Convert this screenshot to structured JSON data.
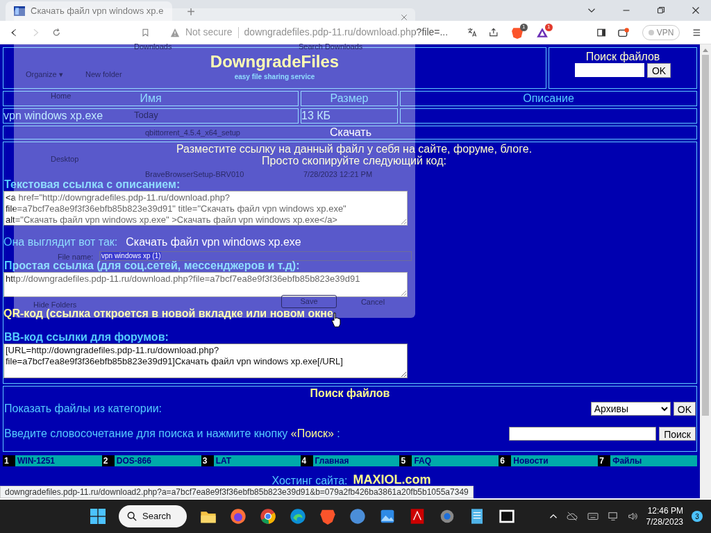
{
  "browser": {
    "tab_title": "Скачать файл vpn windows xp.e",
    "new_tab": "+",
    "security": "Not secure",
    "url": "downgradefiles.pdp-11.ru/download.php?file=...",
    "shields_badge": "1",
    "rewards_badge": "1",
    "vpn": "VPN"
  },
  "site": {
    "logo": "DowngradeFiles",
    "tagline": "easy file sharing service",
    "search_title": "Поиск файлов",
    "search_button": "OK"
  },
  "file_table": {
    "columns": [
      "Имя",
      "Размер",
      "Описание"
    ],
    "row": [
      "vpn windows xp.exe",
      "13 КБ"
    ],
    "download_link": "Скачать"
  },
  "share": {
    "intro": [
      "Разместите ссылку на данный файл у себя на сайте, форуме, блоге.",
      "Просто скопируйте следующий код:"
    ],
    "sections": [
      {
        "kind": "code",
        "label": "Текстовая ссылка с описанием:",
        "value": "<a href=\"http://downgradefiles.pdp-11.ru/download.php?file=a7bcf7ea8e9f3f36ebfb85b823e39d91\" title=\"Скачать файл vpn windows xp.exe\" alt=\"Скачать файл vpn windows xp.exe\" >Скачать файл vpn windows xp.exe</a>"
      },
      {
        "kind": "preview",
        "label": "Она выглядит вот так:",
        "link": "Скачать файл vpn windows xp.exe"
      },
      {
        "kind": "line",
        "label": "Простая ссылка (для соц.сетей, мессенджеров и т.д):",
        "value": "http://downgradefiles.pdp-11.ru/download.php?file=a7bcf7ea8e9f3f36ebfb85b823e39d91"
      },
      {
        "kind": "heading",
        "label": "QR-код (ссылка откроется в новой вкладке или новом окне"
      },
      {
        "kind": "code",
        "label": "BB-код ссылки для форумов:",
        "value": "[URL=http://downgradefiles.pdp-11.ru/download.php?file=a7bcf7ea8e9f3f36ebfb85b823e39d91]Скачать файл vpn windows xp.exe[/URL]"
      }
    ]
  },
  "file_search": {
    "title": "Поиск файлов",
    "category_label": "Показать файлы из категории:",
    "category": "Архивы",
    "category_button": "OK",
    "query_label": "Введите словосочетание для поиска и нажмите кнопку",
    "query_button_name": "«Поиск»",
    "query_label_end": ":",
    "search_button": "Поиск"
  },
  "nav": [
    {
      "number": "1",
      "label": "WIN-1251"
    },
    {
      "number": "2",
      "label": "DOS-866"
    },
    {
      "number": "3",
      "label": "LAT"
    },
    {
      "number": "4",
      "label": "Главная"
    },
    {
      "number": "5",
      "label": "FAQ"
    },
    {
      "number": "6",
      "label": "Новости"
    },
    {
      "number": "7",
      "label": "Файлы"
    }
  ],
  "hosting": {
    "label": "Хостинг сайта:",
    "link": "MAXIOL.com"
  },
  "status_url": "downgradefiles.pdp-11.ru/download2.php?a=a7bcf7ea8e9f3f36ebfb85b823e39d91&b=079a2fb426ba3861a20fb5b1055a7349",
  "save_dialog": {
    "location": "Downloads",
    "search": "Search Downloads",
    "organize": "Organize ▾",
    "new_folder": "New folder",
    "nav": [
      "Home",
      "Desktop"
    ],
    "group": "Today",
    "files": [
      {
        "name": "qbittorrent_4.5.4_x64_setup"
      },
      {
        "name": "BraveBrowserSetup-BRV010",
        "date": "7/28/2023 12:21 PM"
      }
    ],
    "file_name_label": "File name:",
    "file_name": "vpn windows xp (1)",
    "hide_folders": "Hide Folders",
    "save": "Save",
    "cancel": "Cancel"
  },
  "taskbar": {
    "search": "Search",
    "time": "12:46 PM",
    "date": "7/28/2023",
    "notifications": "3"
  }
}
